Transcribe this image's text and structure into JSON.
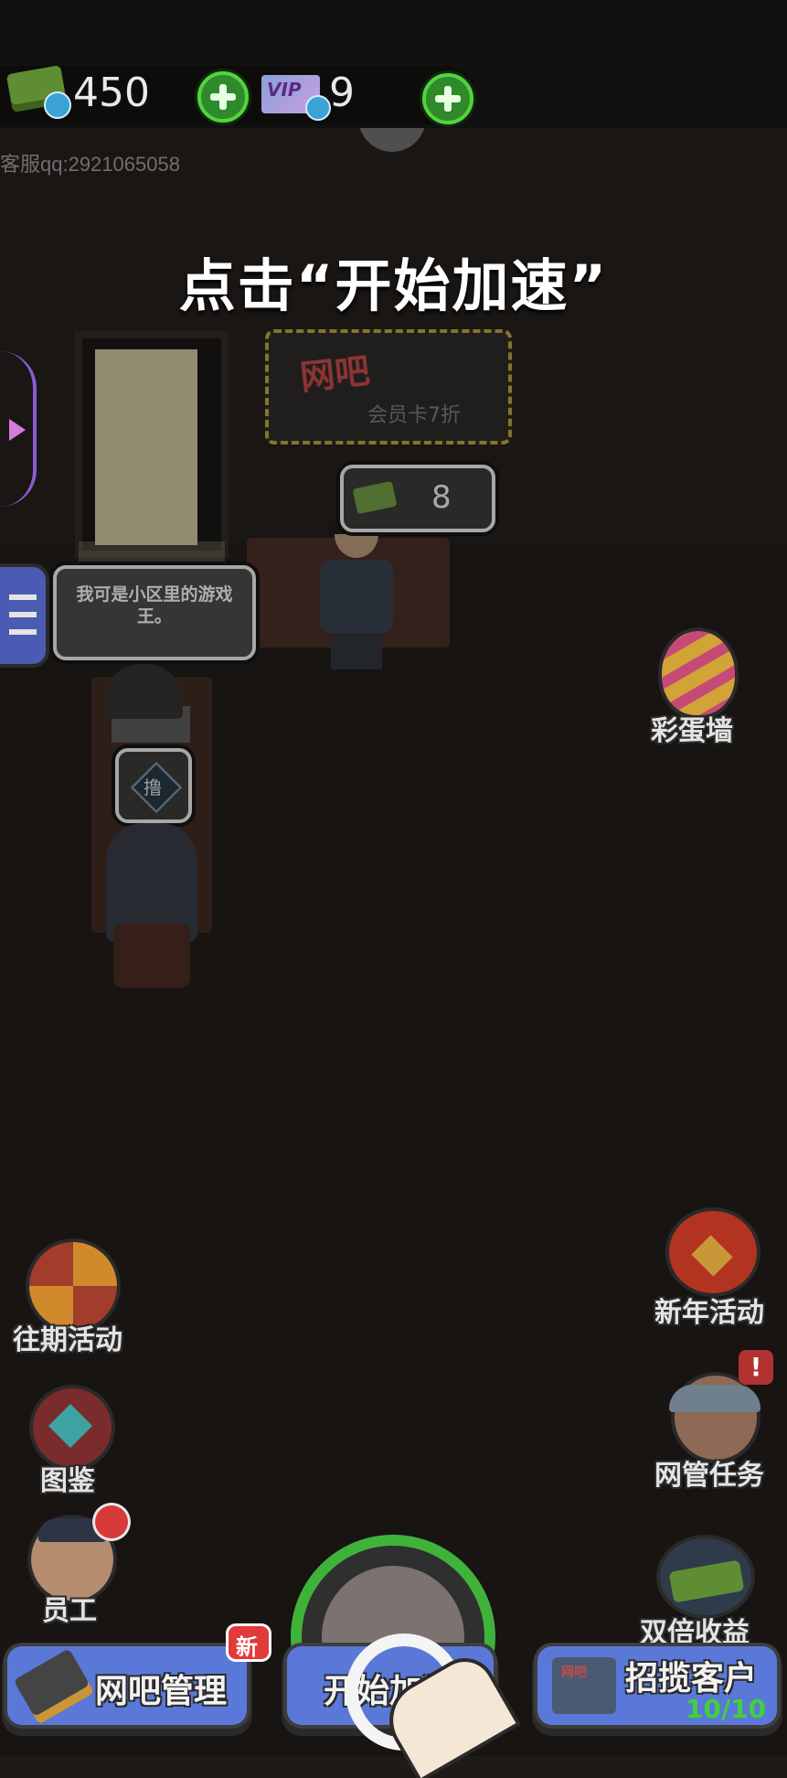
{
  "top_bar": {
    "cash_value": "450",
    "vip_label": "VIP",
    "vip_value": "9"
  },
  "support_text": "客服qq:2921065058",
  "tutorial_hint": "点击“开始加速”",
  "scene": {
    "sign_title": "网吧",
    "sign_subtitle": "会员卡7折",
    "customer_bubble_value": "8",
    "speech_bubble_text": "我可是小区里的游戏王。",
    "pc_badge_text": "撸"
  },
  "side_buttons": {
    "easter_egg_wall": "彩蛋墙",
    "past_events": "往期活动",
    "new_year_event": "新年活动",
    "collection": "图鉴",
    "admin_tasks": "网管任务",
    "staff": "员工",
    "double_income": "双倍收益"
  },
  "bottom_bar": {
    "manage_label": "网吧管理",
    "manage_badge": "新",
    "speedup_label": "开始加速",
    "recruit_label": "招揽客户",
    "recruit_sign": "网吧",
    "recruit_count": "10/10"
  },
  "colors": {
    "accent_green": "#54d33f",
    "button_blue": "#5a78d8",
    "badge_red": "#e23a3a"
  }
}
